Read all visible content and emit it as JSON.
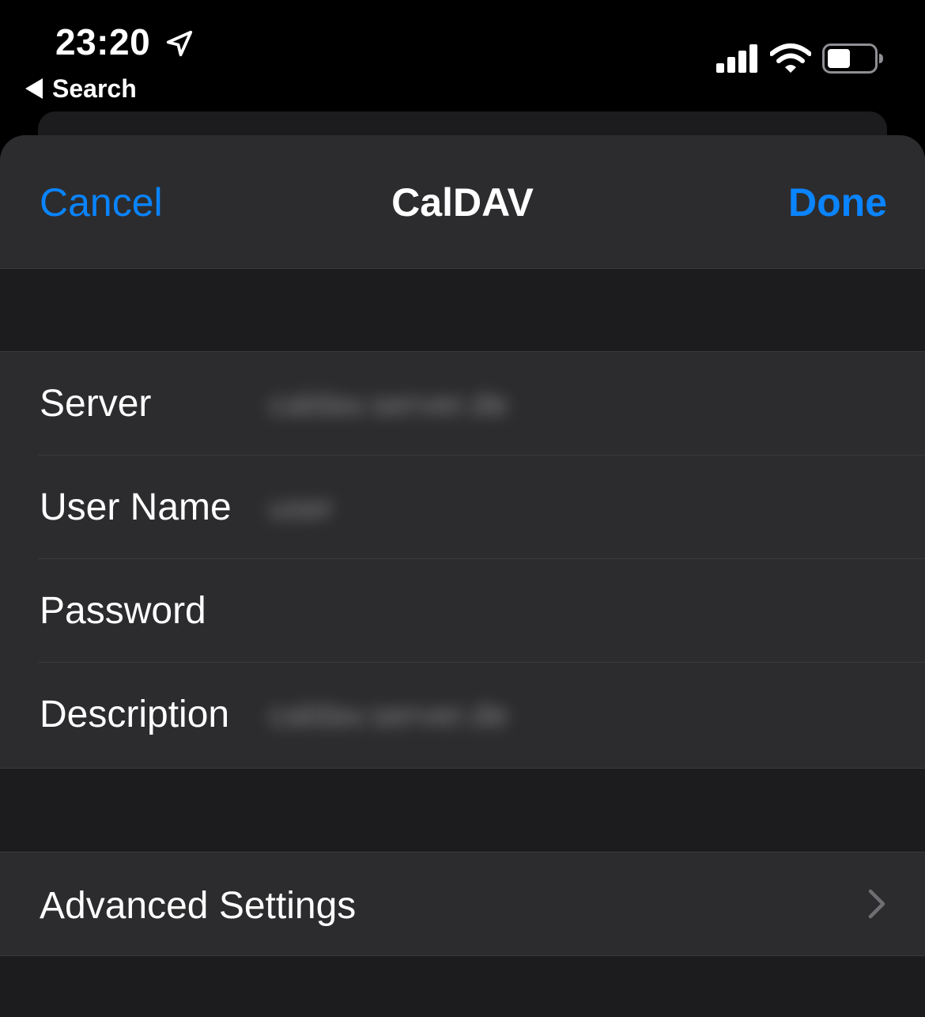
{
  "status_bar": {
    "time": "23:20",
    "back_label": "Search",
    "icons": [
      "location-arrow-icon",
      "cellular-signal-icon",
      "wifi-icon",
      "battery-icon"
    ]
  },
  "nav": {
    "cancel_label": "Cancel",
    "title": "CalDAV",
    "done_label": "Done"
  },
  "fields": [
    {
      "label": "Server",
      "value": "caldav.server.de"
    },
    {
      "label": "User Name",
      "value": "user"
    },
    {
      "label": "Password",
      "value": ""
    },
    {
      "label": "Description",
      "value": "caldav.server.de"
    }
  ],
  "advanced": {
    "label": "Advanced Settings"
  },
  "colors": {
    "accent": "#0a84ff",
    "background": "#000000",
    "sheet": "#1c1c1e",
    "cell": "#2c2c2e",
    "separator": "#3a3a3c"
  }
}
